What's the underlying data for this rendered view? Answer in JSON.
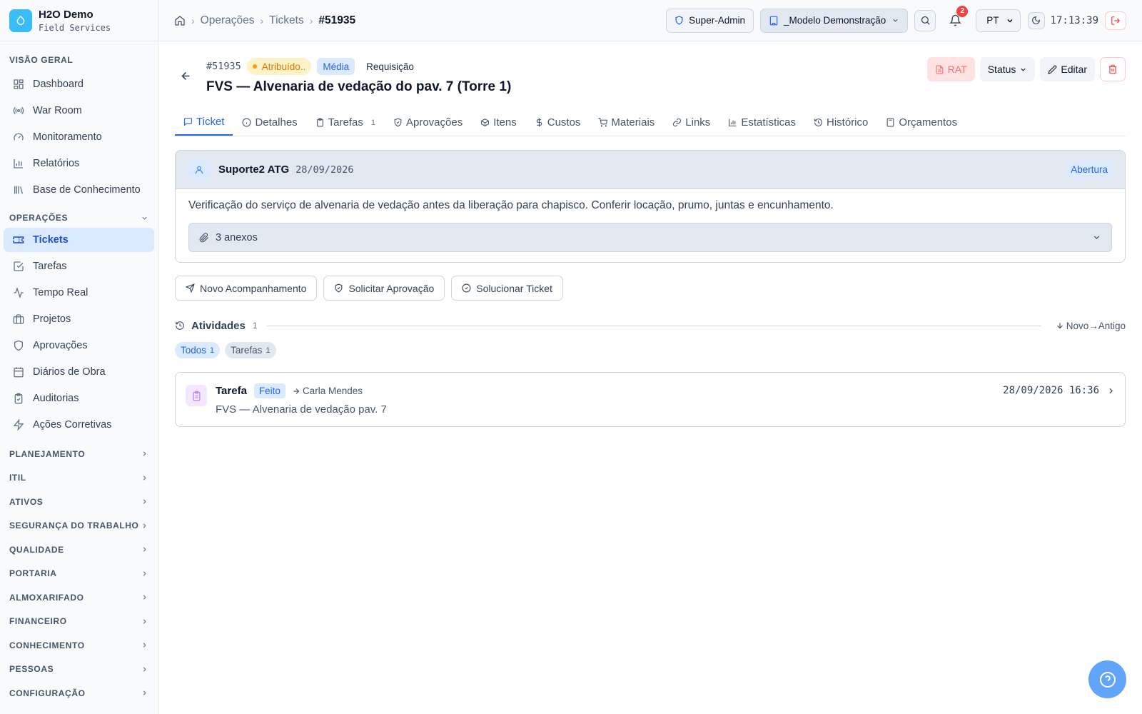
{
  "brand": {
    "name": "H2O Demo",
    "subtitle": "Field Services",
    "color": "#38bdf8"
  },
  "sidebar": {
    "overview_title": "VISÃO GERAL",
    "overview_items": [
      {
        "label": "Dashboard",
        "icon": "dashboard-icon"
      },
      {
        "label": "War Room",
        "icon": "broadcast-icon"
      },
      {
        "label": "Monitoramento",
        "icon": "gauge-icon"
      },
      {
        "label": "Relatórios",
        "icon": "bar-chart-icon"
      },
      {
        "label": "Base de Conhecimento",
        "icon": "library-icon"
      }
    ],
    "operations_title": "OPERAÇÕES",
    "operations_items": [
      {
        "label": "Tickets",
        "icon": "ticket-icon",
        "active": true
      },
      {
        "label": "Tarefas",
        "icon": "check-square-icon"
      },
      {
        "label": "Tempo Real",
        "icon": "activity-icon"
      },
      {
        "label": "Projetos",
        "icon": "briefcase-icon"
      },
      {
        "label": "Aprovações",
        "icon": "shield-icon"
      },
      {
        "label": "Diários de Obra",
        "icon": "calendar-icon"
      },
      {
        "label": "Auditorias",
        "icon": "clipboard-icon"
      },
      {
        "label": "Ações Corretivas",
        "icon": "zap-icon"
      }
    ],
    "collapsed_sections": [
      "PLANEJAMENTO",
      "ITIL",
      "ATIVOS",
      "SEGURANÇA DO TRABALHO",
      "QUALIDADE",
      "PORTARIA",
      "ALMOXARIFADO",
      "FINANCEIRO",
      "CONHECIMENTO",
      "PESSOAS",
      "CONFIGURAÇÃO"
    ]
  },
  "topbar": {
    "breadcrumb": [
      "Operações",
      "Tickets",
      "#51935"
    ],
    "role": "Super-Admin",
    "org": "_Modelo Demonstração",
    "notifications": "2",
    "language": "PT",
    "time": "17:13:39"
  },
  "ticket": {
    "id": "#51935",
    "status": "Atribuído..",
    "priority": "Média",
    "type": "Requisição",
    "title": "FVS — Alvenaria de vedação do pav. 7 (Torre 1)",
    "actions": {
      "rat": "RAT",
      "status": "Status",
      "edit": "Editar"
    }
  },
  "tabs": [
    {
      "label": "Ticket",
      "icon": "message-icon",
      "active": true
    },
    {
      "label": "Detalhes",
      "icon": "info-icon"
    },
    {
      "label": "Tarefas",
      "icon": "clipboard-icon",
      "count": "1"
    },
    {
      "label": "Aprovações",
      "icon": "shield-check-icon"
    },
    {
      "label": "Itens",
      "icon": "package-icon"
    },
    {
      "label": "Custos",
      "icon": "dollar-icon"
    },
    {
      "label": "Materiais",
      "icon": "cart-icon"
    },
    {
      "label": "Links",
      "icon": "link-icon"
    },
    {
      "label": "Estatísticas",
      "icon": "bar-chart-icon"
    },
    {
      "label": "Histórico",
      "icon": "history-icon"
    },
    {
      "label": "Orçamentos",
      "icon": "calculator-icon"
    }
  ],
  "opening": {
    "author": "Suporte2 ATG",
    "date": "28/09/2026",
    "badge": "Abertura",
    "description": "Verificação do serviço de alvenaria de vedação antes da liberação para chapisco. Conferir locação, prumo, juntas e encunhamento.",
    "attachments": "3 anexos"
  },
  "buttons": {
    "follow_up": "Novo Acompanhamento",
    "approval": "Solicitar Aprovação",
    "solve": "Solucionar Ticket"
  },
  "activities": {
    "title": "Atividades",
    "count": "1",
    "sort": "Novo→Antigo",
    "filters": [
      {
        "label": "Todos",
        "count": "1"
      },
      {
        "label": "Tarefas",
        "count": "1"
      }
    ],
    "entries": [
      {
        "type": "Tarefa",
        "status": "Feito",
        "assignee": "Carla Mendes",
        "description": "FVS — Alvenaria de vedação pav. 7",
        "timestamp": "28/09/2026 16:36"
      }
    ]
  }
}
